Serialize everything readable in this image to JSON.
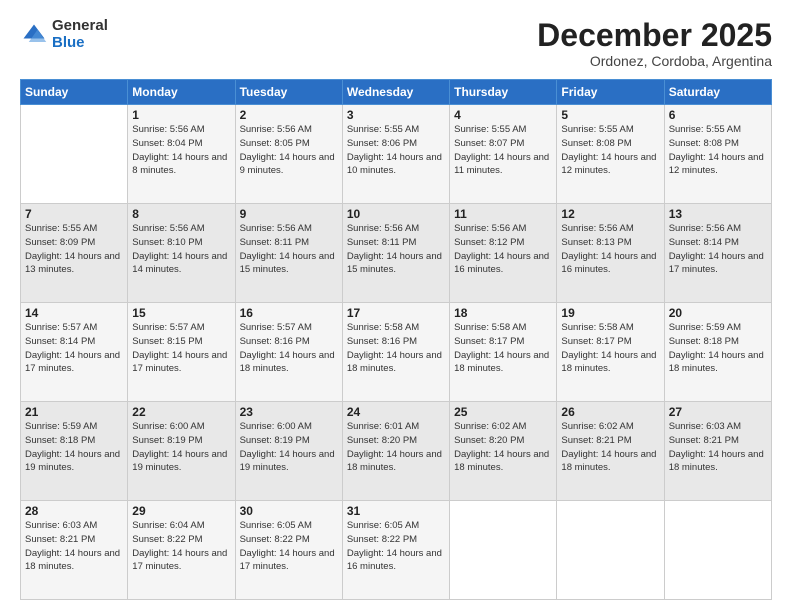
{
  "header": {
    "logo_general": "General",
    "logo_blue": "Blue",
    "month_title": "December 2025",
    "location": "Ordonez, Cordoba, Argentina"
  },
  "calendar": {
    "weekdays": [
      "Sunday",
      "Monday",
      "Tuesday",
      "Wednesday",
      "Thursday",
      "Friday",
      "Saturday"
    ],
    "weeks": [
      [
        {
          "day": "",
          "sunrise": "",
          "sunset": "",
          "daylight": ""
        },
        {
          "day": "1",
          "sunrise": "Sunrise: 5:56 AM",
          "sunset": "Sunset: 8:04 PM",
          "daylight": "Daylight: 14 hours and 8 minutes."
        },
        {
          "day": "2",
          "sunrise": "Sunrise: 5:56 AM",
          "sunset": "Sunset: 8:05 PM",
          "daylight": "Daylight: 14 hours and 9 minutes."
        },
        {
          "day": "3",
          "sunrise": "Sunrise: 5:55 AM",
          "sunset": "Sunset: 8:06 PM",
          "daylight": "Daylight: 14 hours and 10 minutes."
        },
        {
          "day": "4",
          "sunrise": "Sunrise: 5:55 AM",
          "sunset": "Sunset: 8:07 PM",
          "daylight": "Daylight: 14 hours and 11 minutes."
        },
        {
          "day": "5",
          "sunrise": "Sunrise: 5:55 AM",
          "sunset": "Sunset: 8:08 PM",
          "daylight": "Daylight: 14 hours and 12 minutes."
        },
        {
          "day": "6",
          "sunrise": "Sunrise: 5:55 AM",
          "sunset": "Sunset: 8:08 PM",
          "daylight": "Daylight: 14 hours and 12 minutes."
        }
      ],
      [
        {
          "day": "7",
          "sunrise": "Sunrise: 5:55 AM",
          "sunset": "Sunset: 8:09 PM",
          "daylight": "Daylight: 14 hours and 13 minutes."
        },
        {
          "day": "8",
          "sunrise": "Sunrise: 5:56 AM",
          "sunset": "Sunset: 8:10 PM",
          "daylight": "Daylight: 14 hours and 14 minutes."
        },
        {
          "day": "9",
          "sunrise": "Sunrise: 5:56 AM",
          "sunset": "Sunset: 8:11 PM",
          "daylight": "Daylight: 14 hours and 15 minutes."
        },
        {
          "day": "10",
          "sunrise": "Sunrise: 5:56 AM",
          "sunset": "Sunset: 8:11 PM",
          "daylight": "Daylight: 14 hours and 15 minutes."
        },
        {
          "day": "11",
          "sunrise": "Sunrise: 5:56 AM",
          "sunset": "Sunset: 8:12 PM",
          "daylight": "Daylight: 14 hours and 16 minutes."
        },
        {
          "day": "12",
          "sunrise": "Sunrise: 5:56 AM",
          "sunset": "Sunset: 8:13 PM",
          "daylight": "Daylight: 14 hours and 16 minutes."
        },
        {
          "day": "13",
          "sunrise": "Sunrise: 5:56 AM",
          "sunset": "Sunset: 8:14 PM",
          "daylight": "Daylight: 14 hours and 17 minutes."
        }
      ],
      [
        {
          "day": "14",
          "sunrise": "Sunrise: 5:57 AM",
          "sunset": "Sunset: 8:14 PM",
          "daylight": "Daylight: 14 hours and 17 minutes."
        },
        {
          "day": "15",
          "sunrise": "Sunrise: 5:57 AM",
          "sunset": "Sunset: 8:15 PM",
          "daylight": "Daylight: 14 hours and 17 minutes."
        },
        {
          "day": "16",
          "sunrise": "Sunrise: 5:57 AM",
          "sunset": "Sunset: 8:16 PM",
          "daylight": "Daylight: 14 hours and 18 minutes."
        },
        {
          "day": "17",
          "sunrise": "Sunrise: 5:58 AM",
          "sunset": "Sunset: 8:16 PM",
          "daylight": "Daylight: 14 hours and 18 minutes."
        },
        {
          "day": "18",
          "sunrise": "Sunrise: 5:58 AM",
          "sunset": "Sunset: 8:17 PM",
          "daylight": "Daylight: 14 hours and 18 minutes."
        },
        {
          "day": "19",
          "sunrise": "Sunrise: 5:58 AM",
          "sunset": "Sunset: 8:17 PM",
          "daylight": "Daylight: 14 hours and 18 minutes."
        },
        {
          "day": "20",
          "sunrise": "Sunrise: 5:59 AM",
          "sunset": "Sunset: 8:18 PM",
          "daylight": "Daylight: 14 hours and 18 minutes."
        }
      ],
      [
        {
          "day": "21",
          "sunrise": "Sunrise: 5:59 AM",
          "sunset": "Sunset: 8:18 PM",
          "daylight": "Daylight: 14 hours and 19 minutes."
        },
        {
          "day": "22",
          "sunrise": "Sunrise: 6:00 AM",
          "sunset": "Sunset: 8:19 PM",
          "daylight": "Daylight: 14 hours and 19 minutes."
        },
        {
          "day": "23",
          "sunrise": "Sunrise: 6:00 AM",
          "sunset": "Sunset: 8:19 PM",
          "daylight": "Daylight: 14 hours and 19 minutes."
        },
        {
          "day": "24",
          "sunrise": "Sunrise: 6:01 AM",
          "sunset": "Sunset: 8:20 PM",
          "daylight": "Daylight: 14 hours and 18 minutes."
        },
        {
          "day": "25",
          "sunrise": "Sunrise: 6:02 AM",
          "sunset": "Sunset: 8:20 PM",
          "daylight": "Daylight: 14 hours and 18 minutes."
        },
        {
          "day": "26",
          "sunrise": "Sunrise: 6:02 AM",
          "sunset": "Sunset: 8:21 PM",
          "daylight": "Daylight: 14 hours and 18 minutes."
        },
        {
          "day": "27",
          "sunrise": "Sunrise: 6:03 AM",
          "sunset": "Sunset: 8:21 PM",
          "daylight": "Daylight: 14 hours and 18 minutes."
        }
      ],
      [
        {
          "day": "28",
          "sunrise": "Sunrise: 6:03 AM",
          "sunset": "Sunset: 8:21 PM",
          "daylight": "Daylight: 14 hours and 18 minutes."
        },
        {
          "day": "29",
          "sunrise": "Sunrise: 6:04 AM",
          "sunset": "Sunset: 8:22 PM",
          "daylight": "Daylight: 14 hours and 17 minutes."
        },
        {
          "day": "30",
          "sunrise": "Sunrise: 6:05 AM",
          "sunset": "Sunset: 8:22 PM",
          "daylight": "Daylight: 14 hours and 17 minutes."
        },
        {
          "day": "31",
          "sunrise": "Sunrise: 6:05 AM",
          "sunset": "Sunset: 8:22 PM",
          "daylight": "Daylight: 14 hours and 16 minutes."
        },
        {
          "day": "",
          "sunrise": "",
          "sunset": "",
          "daylight": ""
        },
        {
          "day": "",
          "sunrise": "",
          "sunset": "",
          "daylight": ""
        },
        {
          "day": "",
          "sunrise": "",
          "sunset": "",
          "daylight": ""
        }
      ]
    ]
  }
}
